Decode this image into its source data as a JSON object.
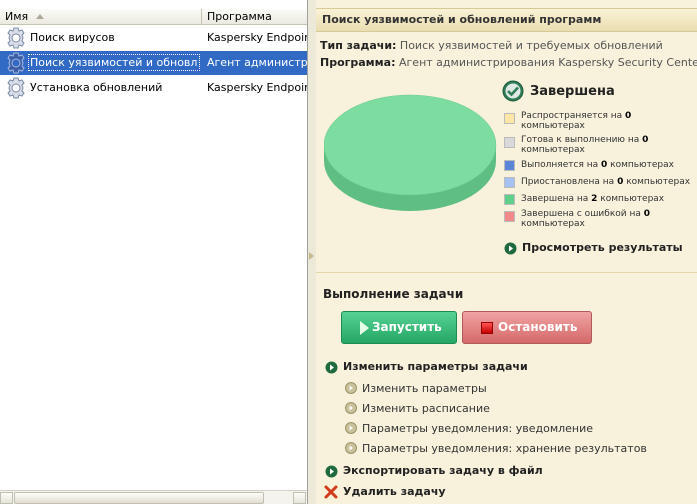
{
  "list": {
    "columns": {
      "name": "Имя",
      "program": "Программа"
    },
    "rows": [
      {
        "name": "Поиск вирусов",
        "program": "Kaspersky Endpoint Security",
        "selected": false
      },
      {
        "name": "Поиск уязвимостей и обновлений программ",
        "program": "Агент администрирования",
        "selected": true
      },
      {
        "name": "Установка обновлений",
        "program": "Kaspersky Endpoint Security",
        "selected": false
      }
    ]
  },
  "details": {
    "title": "Поиск уязвимостей и обновлений программ",
    "task_type_label": "Тип задачи:",
    "task_type_value": "Поиск уязвимостей и требуемых обновлений",
    "program_label": "Программа:",
    "program_value": "Агент администрирования Kaspersky Security Center",
    "status": "Завершена",
    "legend": [
      {
        "pre": "Распространяется на",
        "count": "0",
        "post": "компьютерах",
        "color": "#fde7a6"
      },
      {
        "pre": "Готова к выполнению на",
        "count": "0",
        "post": "компьютерах",
        "color": "#d9d9d9"
      },
      {
        "pre": "Выполняется на",
        "count": "0",
        "post": "компьютерах",
        "color": "#5b86d8"
      },
      {
        "pre": "Приостановлена на",
        "count": "0",
        "post": "компьютерах",
        "color": "#a6c2f2"
      },
      {
        "pre": "Завершена на",
        "count": "2",
        "post": "компьютерах",
        "color": "#5fcf8a"
      },
      {
        "pre": "Завершена с ошибкой на",
        "count": "0",
        "post": "компьютерах",
        "color": "#f08a8a"
      }
    ],
    "view_results": "Просмотреть результаты",
    "pie_color": "#7ddc9f"
  },
  "execution": {
    "title": "Выполнение задачи",
    "start_label": "Запустить",
    "stop_label": "Остановить"
  },
  "actions": {
    "change_params": "Изменить параметры задачи",
    "sub": [
      "Изменить параметры",
      "Изменить расписание",
      "Параметры уведомления: уведомление",
      "Параметры уведомления: хранение результатов"
    ],
    "export": "Экспортировать задачу в файл",
    "delete": "Удалить задачу"
  }
}
